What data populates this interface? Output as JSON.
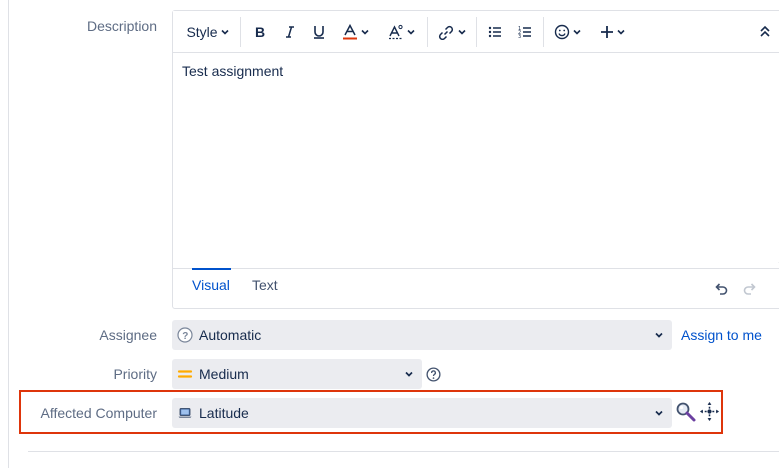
{
  "description": {
    "label": "Description",
    "toolbar": {
      "style_label": "Style",
      "buttons": [
        "bold-icon",
        "italic-icon",
        "underline-icon",
        "text-color-icon",
        "clear-format-icon",
        "link-icon",
        "bullet-list-icon",
        "numbered-list-icon",
        "emoji-icon",
        "insert-more-icon",
        "collapse-toolbar-icon"
      ]
    },
    "content": "Test assignment",
    "tabs": [
      {
        "label": "Visual",
        "active": true
      },
      {
        "label": "Text",
        "active": false
      }
    ]
  },
  "assignee": {
    "label": "Assignee",
    "value": "Automatic",
    "icon": "unknown-user-icon",
    "assign_to_me": "Assign to me"
  },
  "priority": {
    "label": "Priority",
    "value": "Medium",
    "icon": "priority-medium-icon"
  },
  "affected_computer": {
    "label": "Affected Computer",
    "value": "Latitude",
    "icon": "laptop-icon",
    "highlight_color": "#de350b"
  },
  "colors": {
    "accent": "#0052cc",
    "priority_medium": "#ffab00",
    "highlight": "#de350b"
  }
}
